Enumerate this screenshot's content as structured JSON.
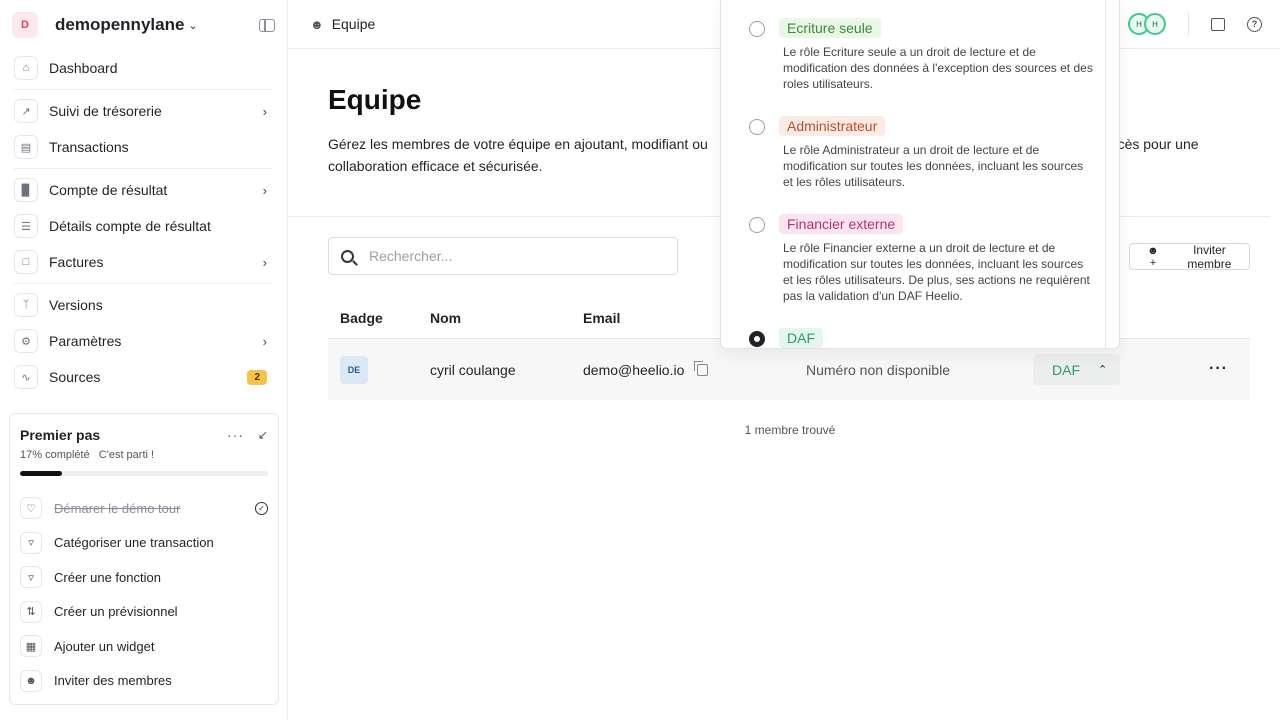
{
  "workspace": {
    "avatar": "D",
    "name": "demopennylane"
  },
  "sidebar": {
    "items": [
      {
        "label": "Dashboard"
      },
      {
        "label": "Suivi de trésorerie"
      },
      {
        "label": "Transactions"
      },
      {
        "label": "Compte de résultat"
      },
      {
        "label": "Détails compte de résultat"
      },
      {
        "label": "Factures"
      },
      {
        "label": "Versions"
      },
      {
        "label": "Paramètres"
      },
      {
        "label": "Sources",
        "badge": "2"
      }
    ]
  },
  "onboarding": {
    "title": "Premier pas",
    "progress_text": "17% complété",
    "progress_sub": "C'est parti !",
    "progress_fraction": 0.17,
    "items": [
      {
        "label": "Démarer le démo tour",
        "done": true
      },
      {
        "label": "Catégoriser une transaction"
      },
      {
        "label": "Créer une fonction"
      },
      {
        "label": "Créer un prévisionnel"
      },
      {
        "label": "Ajouter un widget"
      },
      {
        "label": "Inviter des membres"
      }
    ]
  },
  "topbar": {
    "title": "Equipe",
    "avatars": [
      "H",
      "H"
    ]
  },
  "page": {
    "title": "Equipe",
    "description_a": "Gérez les membres de votre équipe en ajoutant, modifiant ou",
    "description_b": "accès pour une",
    "description_c": "collaboration efficace et sécurisée."
  },
  "search": {
    "placeholder": "Rechercher..."
  },
  "invite_button": "Inviter membre",
  "table": {
    "headers": {
      "badge": "Badge",
      "name": "Nom",
      "email": "Email"
    },
    "rows": [
      {
        "badge": "DE",
        "name": "cyril coulange",
        "email": "demo@heelio.io",
        "phone": "Numéro non disponible",
        "role": "DAF"
      }
    ],
    "footer": "1 membre trouvé"
  },
  "roles": {
    "options": [
      {
        "tag": "Ecriture seule",
        "desc": "Le rôle Ecriture seule a un droit de lecture et de modification des données à l'exception des sources et des roles utilisateurs.",
        "color": "#3a8a3a",
        "bg": "#eaf6e6"
      },
      {
        "tag": "Administrateur",
        "desc": "Le rôle Administrateur a un droit de lecture et de modification sur toutes les données, incluant les sources et les rôles utilisateurs.",
        "color": "#b8502e",
        "bg": "#fbebe4"
      },
      {
        "tag": "Financier externe",
        "desc": "Le rôle Financier externe a un droit de lecture et de modification sur toutes les données, incluant les sources et les rôles utilisateurs. De plus, ses actions ne requièrent pas la validation d'un DAF Heelio.",
        "color": "#b8326e",
        "bg": "#fbe5ee"
      },
      {
        "tag": "DAF",
        "desc": "",
        "color": "#2e9965",
        "bg": "#e5f6ec",
        "selected": true
      }
    ]
  }
}
